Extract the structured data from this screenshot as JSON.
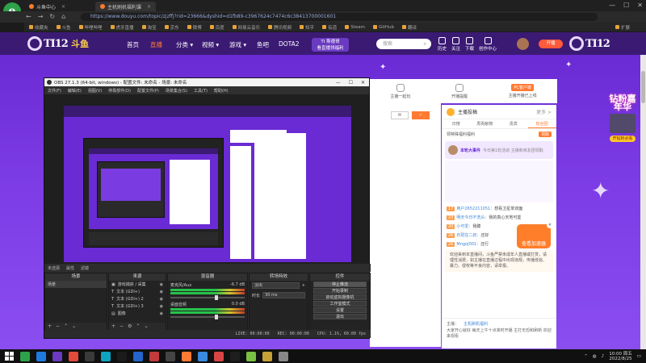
{
  "browser": {
    "tabs": [
      {
        "label": "斗鱼中心",
        "active": false
      },
      {
        "label": "主机刷机福利课",
        "active": true
      }
    ],
    "url": "https://www.douyu.com/topic/zjzffj?rid=23666&dyshid=d1fb89-c3967624c7474c6c38413700001601",
    "bookmarks": [
      "收藏夹",
      "斗鱼",
      "哔哩哔哩",
      "虎牙直播",
      "淘宝",
      "京东",
      "微博",
      "百度",
      "网易云音乐",
      "腾讯视频",
      "知乎",
      "有道",
      "Steam",
      "GitHub",
      "翻译"
    ],
    "extra_bookmark": "扩展",
    "window_controls": [
      "—",
      "☐",
      "✕"
    ]
  },
  "douyu": {
    "logo_text": "TI12",
    "brand": "斗鱼",
    "nav": [
      {
        "label": "首页",
        "selected": false
      },
      {
        "label": "直播",
        "selected": true
      },
      {
        "label": "分类 ▾",
        "selected": false
      },
      {
        "label": "视频 ▾",
        "selected": false
      },
      {
        "label": "游戏 ▾",
        "selected": false
      },
      {
        "label": "鱼吧",
        "selected": false
      },
      {
        "label": "DOTA2",
        "selected": false
      }
    ],
    "ti_badge_line1": "TI 斯德哥",
    "ti_badge_line2": "看直播领福利",
    "search_placeholder": "搜索",
    "header_icons": [
      "历史",
      "关注",
      "下载",
      "创作中心"
    ],
    "record_button": "开播",
    "toolbar": [
      "主播一起玩",
      "开播提醒",
      "PC客户端"
    ],
    "pc_client_label": "PC客户端",
    "follow_label": "主播开播已上线"
  },
  "chat": {
    "top_label": "主播投稿",
    "top_link": "更多 >",
    "tabs": [
      {
        "label": "日榜",
        "selected": false
      },
      {
        "label": "周贡献榜",
        "selected": false
      },
      {
        "label": "贵宾",
        "selected": false
      },
      {
        "label": "粉丝团",
        "selected": true
      }
    ],
    "notice": "领特殊福利福利",
    "notice_btn": "领取",
    "banner_title": "本轮大事件",
    "banner_text": "今日第1轮活动 主播和亲友团领取",
    "lines": [
      {
        "level": "17",
        "user": "用户2652211051：",
        "text": "想看卫星单双面"
      },
      {
        "level": "23",
        "user": "明天今日不洗头：",
        "text": "我的真心天地可鉴"
      },
      {
        "level": "20",
        "user": "小可爱：",
        "text": "我膝"
      },
      {
        "level": "26",
        "user": "石斑在二叔：",
        "text": "还好"
      },
      {
        "level": "26",
        "user": "MngoJ001：",
        "text": "还行"
      }
    ],
    "system_text": "欢迎来到本直播间，斗鱼严禁未成年人直播或打赏，请理性消费，如主播在直播过程中出现违规，传播低俗、暴力、侵权等不良内容，请举报。",
    "input_label": "主播：",
    "input_link": "主机刷机福利",
    "input_text": "大家开心就好 每天上午十点准时开播 主打无恐和刷新 欢迎来观看",
    "rocket_label": "查看加速器",
    "rocket_close": "✕"
  },
  "promo": {
    "title": "钻粉嘉年华",
    "button": "开钻粉必看"
  },
  "obs": {
    "title": "OBS 27.1.3 (64-bit, windows) - 配置文件: 未命名 - 场景: 未命名",
    "menu": [
      "文件(F)",
      "编辑(E)",
      "视图(V)",
      "停靠部件(D)",
      "配置文件(P)",
      "场景集合(S)",
      "工具(T)",
      "帮助(H)"
    ],
    "status_row": [
      "未选源",
      "属性",
      "滤镜"
    ],
    "docks": {
      "scenes": {
        "title": "场景",
        "items": [
          "场景"
        ]
      },
      "sources": {
        "title": "来源",
        "items": [
          "游戏捕获 / 采集",
          "文本 (GDI+)",
          "文本 (GDI+) 2",
          "文本 (GDI+) 3",
          "图像",
          "显示器采集"
        ]
      },
      "mixer": {
        "title": "混音器",
        "channels": [
          {
            "name": "麦克风/Aux",
            "db": "-6.7 dB"
          },
          {
            "name": "桌面音频",
            "db": "0.0 dB"
          }
        ]
      },
      "transitions": {
        "title": "转场特效",
        "selected": "淡出",
        "duration_label": "时长",
        "duration_value": "30 ms"
      },
      "controls": {
        "title": "控件",
        "buttons": [
          "停止推流",
          "开始录制",
          "启动虚拟摄像机",
          "工作室模式",
          "设置",
          "退出"
        ]
      }
    },
    "bottom": [
      "LIVE: 00:00:00",
      "REC: 00:00:00",
      "CPU: 1.1%, 60.00 fps"
    ]
  },
  "taskbar": {
    "icons": [
      "#2ea24a",
      "#1f7ae0",
      "#6a3ac0",
      "#e24a3a",
      "#3a3a3a",
      "#0fa3c2",
      "#1b1b1b",
      "#2266cc",
      "#c23a3a",
      "#444",
      "#ff7a33",
      "#3a8adf",
      "#d94545",
      "#1e1e1e",
      "#7ac043",
      "#c7a135",
      "#888"
    ],
    "time": "10:00 周五",
    "date": "2022/8/25"
  }
}
